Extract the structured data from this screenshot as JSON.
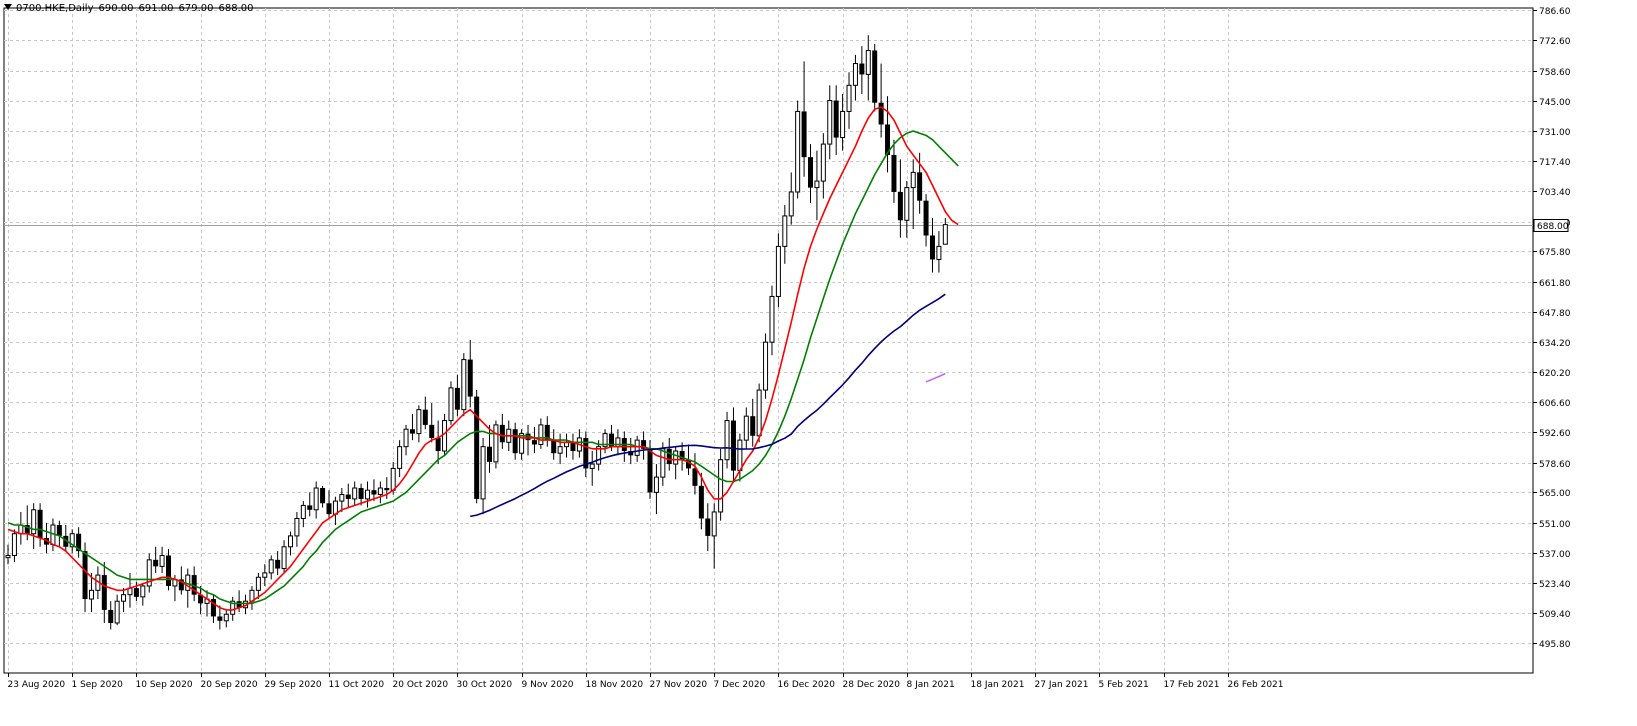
{
  "header": {
    "symbol": "0700.HKE,Daily",
    "open": "690.00",
    "high": "691.00",
    "low": "679.00",
    "close": "688.00"
  },
  "colors": {
    "background": "#ffffff",
    "grid": "#c8c8c8",
    "candle": "#000000",
    "ma_fast": "#ff0000",
    "ma_mid": "#008000",
    "ma_slow": "#000080",
    "ma_long": "#cc66ee",
    "price_line": "#a0a0a0"
  },
  "chart_data": {
    "type": "candlestick",
    "title": "0700.HKE,Daily",
    "last_price": 688.0,
    "last_price_label": "688.00",
    "grid": true,
    "y_axis": {
      "position": "right",
      "range": [
        495.8,
        786.6
      ],
      "ticks": [
        786.6,
        772.6,
        758.6,
        745.0,
        731.0,
        717.4,
        703.4,
        689.4,
        675.8,
        661.8,
        647.8,
        634.2,
        620.2,
        606.6,
        592.6,
        578.6,
        565.0,
        551.0,
        537.0,
        523.4,
        509.4,
        495.8
      ],
      "tick_labels": [
        "786.60",
        "772.60",
        "758.60",
        "745.00",
        "731.00",
        "717.40",
        "703.40",
        "689.40",
        "675.80",
        "661.80",
        "647.80",
        "634.20",
        "620.20",
        "606.60",
        "592.60",
        "578.60",
        "565.00",
        "551.00",
        "537.00",
        "523.40",
        "509.40",
        "495.80"
      ]
    },
    "x_axis": {
      "tick_labels": [
        "23 Aug 2020",
        "1 Sep 2020",
        "10 Sep 2020",
        "20 Sep 2020",
        "29 Sep 2020",
        "11 Oct 2020",
        "20 Oct 2020",
        "30 Oct 2020",
        "9 Nov 2020",
        "18 Nov 2020",
        "27 Nov 2020",
        "7 Dec 2020",
        "16 Dec 2020",
        "28 Dec 2020",
        "8 Jan 2021",
        "18 Jan 2021",
        "27 Jan 2021",
        "5 Feb 2021",
        "17 Feb 2021",
        "26 Feb 2021"
      ],
      "tick_index": [
        0,
        10,
        20,
        30,
        40,
        50,
        60,
        70,
        80,
        90,
        100,
        110,
        120,
        130,
        140,
        150,
        160,
        170,
        180,
        190
      ]
    },
    "candles": [
      [
        535,
        541,
        532,
        536
      ],
      [
        536,
        548,
        533,
        546
      ],
      [
        546,
        556,
        541,
        550
      ],
      [
        550,
        559,
        543,
        546
      ],
      [
        546,
        560,
        539,
        557
      ],
      [
        557,
        560,
        540,
        544
      ],
      [
        544,
        551,
        537,
        541
      ],
      [
        541,
        553,
        538,
        550
      ],
      [
        550,
        552,
        540,
        545
      ],
      [
        545,
        550,
        538,
        540
      ],
      [
        540,
        548,
        537,
        546
      ],
      [
        546,
        549,
        535,
        538
      ],
      [
        538,
        542,
        510,
        516
      ],
      [
        516,
        528,
        510,
        520
      ],
      [
        520,
        531,
        516,
        527
      ],
      [
        527,
        533,
        505,
        511
      ],
      [
        511,
        515,
        502,
        505
      ],
      [
        505,
        518,
        504,
        515
      ],
      [
        515,
        521,
        510,
        518
      ],
      [
        518,
        528,
        512,
        521
      ],
      [
        521,
        524,
        515,
        517
      ],
      [
        517,
        523,
        513,
        522
      ],
      [
        522,
        537,
        519,
        534
      ],
      [
        534,
        540,
        528,
        531
      ],
      [
        531,
        540,
        528,
        536
      ],
      [
        536,
        539,
        520,
        522
      ],
      [
        522,
        527,
        515,
        525
      ],
      [
        525,
        531,
        518,
        520
      ],
      [
        520,
        530,
        512,
        527
      ],
      [
        527,
        531,
        515,
        518
      ],
      [
        518,
        522,
        509,
        514
      ],
      [
        514,
        520,
        508,
        516
      ],
      [
        516,
        518,
        505,
        508
      ],
      [
        508,
        513,
        502,
        506
      ],
      [
        506,
        511,
        503,
        509
      ],
      [
        509,
        517,
        506,
        515
      ],
      [
        515,
        520,
        510,
        512
      ],
      [
        512,
        518,
        509,
        515
      ],
      [
        515,
        522,
        511,
        520
      ],
      [
        520,
        528,
        516,
        526
      ],
      [
        526,
        532,
        522,
        528
      ],
      [
        528,
        536,
        525,
        534
      ],
      [
        534,
        538,
        527,
        530
      ],
      [
        530,
        543,
        528,
        540
      ],
      [
        540,
        547,
        536,
        545
      ],
      [
        545,
        556,
        540,
        553
      ],
      [
        553,
        561,
        549,
        559
      ],
      [
        559,
        565,
        554,
        557
      ],
      [
        557,
        570,
        553,
        567
      ],
      [
        567,
        568,
        558,
        560
      ],
      [
        560,
        566,
        553,
        555
      ],
      [
        555,
        563,
        550,
        561
      ],
      [
        561,
        567,
        556,
        564
      ],
      [
        564,
        569,
        558,
        562
      ],
      [
        562,
        570,
        559,
        567
      ],
      [
        567,
        569,
        559,
        562
      ],
      [
        562,
        570,
        558,
        566
      ],
      [
        566,
        571,
        561,
        564
      ],
      [
        564,
        570,
        560,
        567
      ],
      [
        567,
        572,
        562,
        566
      ],
      [
        566,
        579,
        564,
        576
      ],
      [
        576,
        589,
        572,
        586
      ],
      [
        586,
        596,
        582,
        594
      ],
      [
        594,
        601,
        589,
        592
      ],
      [
        592,
        605,
        588,
        603
      ],
      [
        603,
        609,
        594,
        596
      ],
      [
        596,
        606,
        588,
        590
      ],
      [
        590,
        598,
        578,
        584
      ],
      [
        584,
        601,
        582,
        598
      ],
      [
        598,
        616,
        596,
        613
      ],
      [
        613,
        619,
        600,
        603
      ],
      [
        603,
        629,
        600,
        626
      ],
      [
        626,
        635,
        604,
        609
      ],
      [
        609,
        612,
        560,
        562
      ],
      [
        562,
        590,
        555,
        586
      ],
      [
        586,
        596,
        574,
        579
      ],
      [
        579,
        598,
        576,
        596
      ],
      [
        596,
        601,
        585,
        588
      ],
      [
        588,
        598,
        584,
        594
      ],
      [
        594,
        597,
        580,
        583
      ],
      [
        583,
        594,
        580,
        592
      ],
      [
        592,
        596,
        582,
        589
      ],
      [
        589,
        595,
        583,
        587
      ],
      [
        587,
        599,
        585,
        596
      ],
      [
        596,
        600,
        586,
        589
      ],
      [
        589,
        594,
        580,
        583
      ],
      [
        583,
        592,
        578,
        586
      ],
      [
        586,
        592,
        581,
        588
      ],
      [
        588,
        592,
        580,
        584
      ],
      [
        584,
        594,
        581,
        590
      ],
      [
        590,
        593,
        572,
        576
      ],
      [
        576,
        584,
        568,
        578
      ],
      [
        578,
        589,
        575,
        586
      ],
      [
        586,
        594,
        583,
        592
      ],
      [
        592,
        596,
        584,
        586
      ],
      [
        586,
        594,
        582,
        590
      ],
      [
        590,
        593,
        579,
        584
      ],
      [
        584,
        590,
        578,
        582
      ],
      [
        582,
        591,
        579,
        589
      ],
      [
        589,
        593,
        580,
        585
      ],
      [
        585,
        589,
        562,
        565
      ],
      [
        565,
        578,
        555,
        572
      ],
      [
        572,
        588,
        568,
        585
      ],
      [
        585,
        590,
        575,
        578
      ],
      [
        578,
        586,
        571,
        584
      ],
      [
        584,
        588,
        575,
        580
      ],
      [
        580,
        587,
        573,
        576
      ],
      [
        576,
        583,
        564,
        568
      ],
      [
        568,
        574,
        548,
        553
      ],
      [
        553,
        560,
        538,
        545
      ],
      [
        545,
        560,
        530,
        556
      ],
      [
        556,
        585,
        552,
        580
      ],
      [
        580,
        602,
        576,
        598
      ],
      [
        598,
        604,
        570,
        575
      ],
      [
        575,
        592,
        570,
        589
      ],
      [
        589,
        604,
        585,
        600
      ],
      [
        600,
        608,
        586,
        591
      ],
      [
        591,
        615,
        588,
        612
      ],
      [
        612,
        638,
        608,
        634
      ],
      [
        634,
        660,
        628,
        655
      ],
      [
        655,
        684,
        650,
        678
      ],
      [
        678,
        697,
        670,
        692
      ],
      [
        692,
        712,
        688,
        703
      ],
      [
        703,
        745,
        700,
        740
      ],
      [
        740,
        763,
        710,
        719
      ],
      [
        719,
        725,
        698,
        705
      ],
      [
        705,
        722,
        690,
        708
      ],
      [
        708,
        730,
        700,
        725
      ],
      [
        725,
        752,
        718,
        745
      ],
      [
        745,
        752,
        720,
        728
      ],
      [
        728,
        748,
        722,
        740
      ],
      [
        740,
        758,
        732,
        752
      ],
      [
        752,
        766,
        745,
        762
      ],
      [
        762,
        770,
        748,
        757
      ],
      [
        757,
        775,
        745,
        768
      ],
      [
        768,
        771,
        740,
        744
      ],
      [
        744,
        762,
        728,
        734
      ],
      [
        734,
        747,
        712,
        720
      ],
      [
        720,
        727,
        698,
        703
      ],
      [
        703,
        718,
        682,
        690
      ],
      [
        690,
        708,
        682,
        705
      ],
      [
        705,
        718,
        686,
        712
      ],
      [
        712,
        721,
        693,
        699
      ],
      [
        699,
        702,
        678,
        683
      ],
      [
        683,
        691,
        666,
        672
      ],
      [
        672,
        685,
        666,
        678
      ],
      [
        679,
        691,
        679,
        688
      ]
    ],
    "ma_fast": [
      548,
      547,
      546,
      546,
      545,
      544,
      543,
      541,
      540,
      538,
      535,
      532,
      529,
      526,
      524,
      522,
      521,
      520,
      520,
      521,
      522,
      523,
      524,
      525,
      526,
      526,
      525,
      524,
      522,
      520,
      518,
      516,
      514,
      512,
      511,
      511,
      512,
      513,
      515,
      517,
      519,
      522,
      525,
      528,
      531,
      535,
      539,
      543,
      547,
      551,
      553,
      555,
      557,
      558,
      559,
      560,
      561,
      562,
      563,
      564,
      566,
      569,
      573,
      578,
      583,
      587,
      589,
      590,
      592,
      595,
      598,
      601,
      603,
      600,
      597,
      594,
      592,
      591,
      591,
      591,
      590,
      590,
      590,
      589,
      589,
      589,
      588,
      588,
      588,
      587,
      586,
      585,
      585,
      585,
      586,
      586,
      586,
      586,
      586,
      586,
      584,
      582,
      581,
      580,
      580,
      580,
      579,
      577,
      572,
      566,
      562,
      562,
      565,
      570,
      575,
      580,
      584,
      590,
      598,
      608,
      619,
      631,
      643,
      656,
      668,
      678,
      686,
      693,
      700,
      706,
      712,
      718,
      724,
      731,
      737,
      741,
      742,
      740,
      736,
      730,
      724,
      720,
      716,
      712,
      706,
      700,
      694,
      690,
      688
    ],
    "ma_mid": [
      551,
      550,
      550,
      549,
      548,
      548,
      547,
      546,
      545,
      543,
      541,
      539,
      537,
      535,
      533,
      531,
      529,
      527,
      526,
      525,
      525,
      525,
      525,
      525,
      525,
      525,
      525,
      524,
      523,
      522,
      521,
      519,
      518,
      516,
      515,
      514,
      514,
      514,
      514,
      515,
      516,
      518,
      520,
      522,
      525,
      528,
      531,
      535,
      538,
      542,
      545,
      548,
      550,
      552,
      554,
      556,
      557,
      558,
      559,
      560,
      561,
      563,
      565,
      568,
      571,
      574,
      577,
      580,
      582,
      585,
      588,
      590,
      592,
      593,
      593,
      592,
      592,
      591,
      591,
      591,
      591,
      591,
      590,
      590,
      590,
      589,
      589,
      589,
      588,
      588,
      588,
      588,
      587,
      587,
      587,
      587,
      587,
      587,
      586,
      586,
      585,
      585,
      584,
      583,
      582,
      581,
      580,
      579,
      577,
      575,
      573,
      571,
      570,
      570,
      571,
      573,
      575,
      578,
      582,
      587,
      593,
      600,
      608,
      617,
      626,
      636,
      645,
      654,
      663,
      671,
      679,
      686,
      693,
      699,
      705,
      711,
      716,
      721,
      725,
      728,
      730,
      731,
      730,
      729,
      727,
      724,
      721,
      718,
      715
    ]
  }
}
